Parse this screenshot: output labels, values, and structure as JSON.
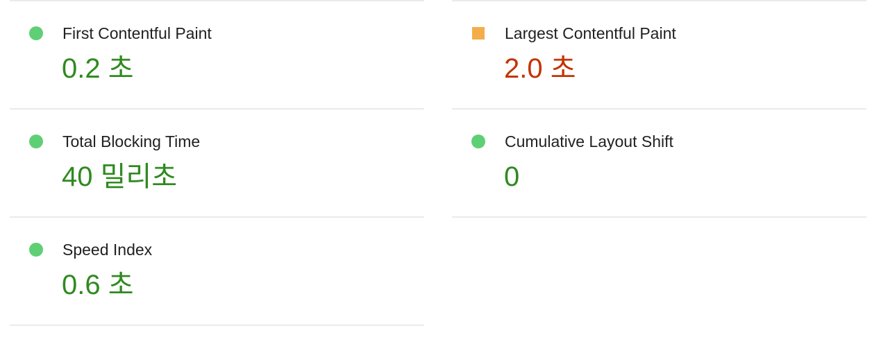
{
  "metrics": [
    {
      "title": "First Contentful Paint",
      "value": "0.2 초",
      "status": "pass"
    },
    {
      "title": "Largest Contentful Paint",
      "value": "2.0 초",
      "status": "average"
    },
    {
      "title": "Total Blocking Time",
      "value": "40 밀리초",
      "status": "pass"
    },
    {
      "title": "Cumulative Layout Shift",
      "value": "0",
      "status": "pass"
    },
    {
      "title": "Speed Index",
      "value": "0.6 초",
      "status": "pass"
    }
  ],
  "colors": {
    "pass_indicator": "#5fcf76",
    "pass_text": "#2f8a1f",
    "average_indicator": "#f4ad4a",
    "average_text": "#c33300",
    "divider": "#ebebeb"
  }
}
